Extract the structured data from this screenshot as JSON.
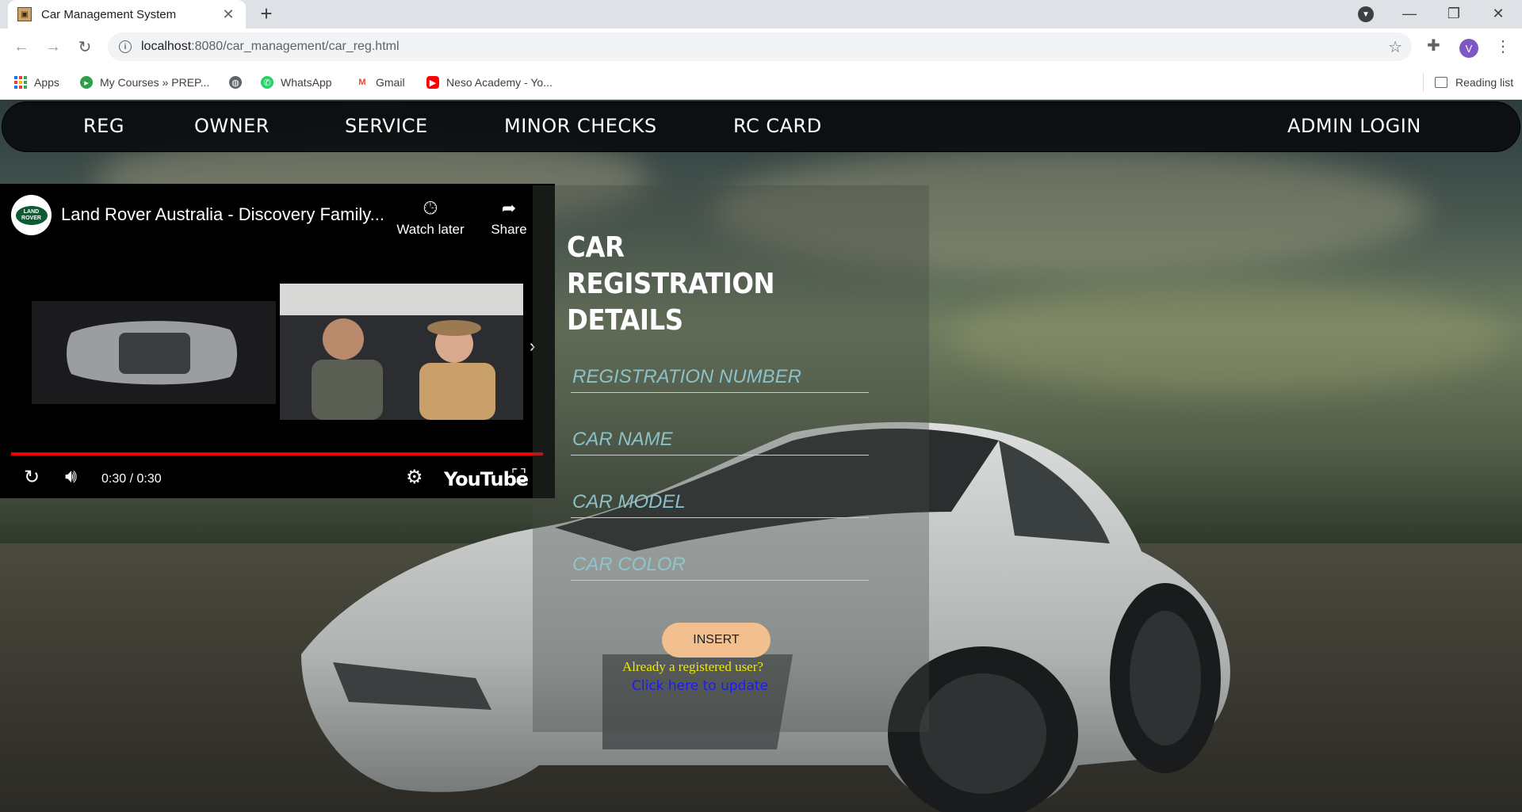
{
  "browser": {
    "tab_title": "Car Management System",
    "url_host": "localhost",
    "url_rest": ":8080/car_management/car_reg.html",
    "bookmarks": [
      "Apps",
      "My Courses » PREP...",
      "WhatsApp",
      "Gmail",
      "Neso Academy - Yo..."
    ],
    "reading_list": "Reading list",
    "profile_initial": "V"
  },
  "nav": {
    "reg": "REG",
    "owner": "OWNER",
    "service": "SERVICE",
    "minor_checks": "MINOR CHECKS",
    "rc_card": "RC CARD",
    "admin_login": "ADMIN LOGIN"
  },
  "video": {
    "channel_logo": "LAND ROVER",
    "title": "Land Rover Australia - Discovery Family...",
    "watch_later": "Watch later",
    "share": "Share",
    "time": "0:30 / 0:30",
    "brand": "YouTube",
    "progress": 1.0
  },
  "form": {
    "title_line1": "CAR",
    "title_line2": "REGISTRATION",
    "title_line3": "DETAILS",
    "reg_placeholder": "REGISTRATION NUMBER",
    "name_placeholder": "CAR NAME",
    "model_placeholder": "CAR MODEL",
    "color_placeholder": "CAR COLOR",
    "insert_label": "INSERT",
    "already_text": "Already a registered user?",
    "update_link": "Click here to update"
  },
  "colors": {
    "accent_button": "#f2c08e",
    "placeholder": "#8ec7cf",
    "already_text": "#f0e800",
    "link": "#1a1aff",
    "video_progress": "#ee0000"
  }
}
